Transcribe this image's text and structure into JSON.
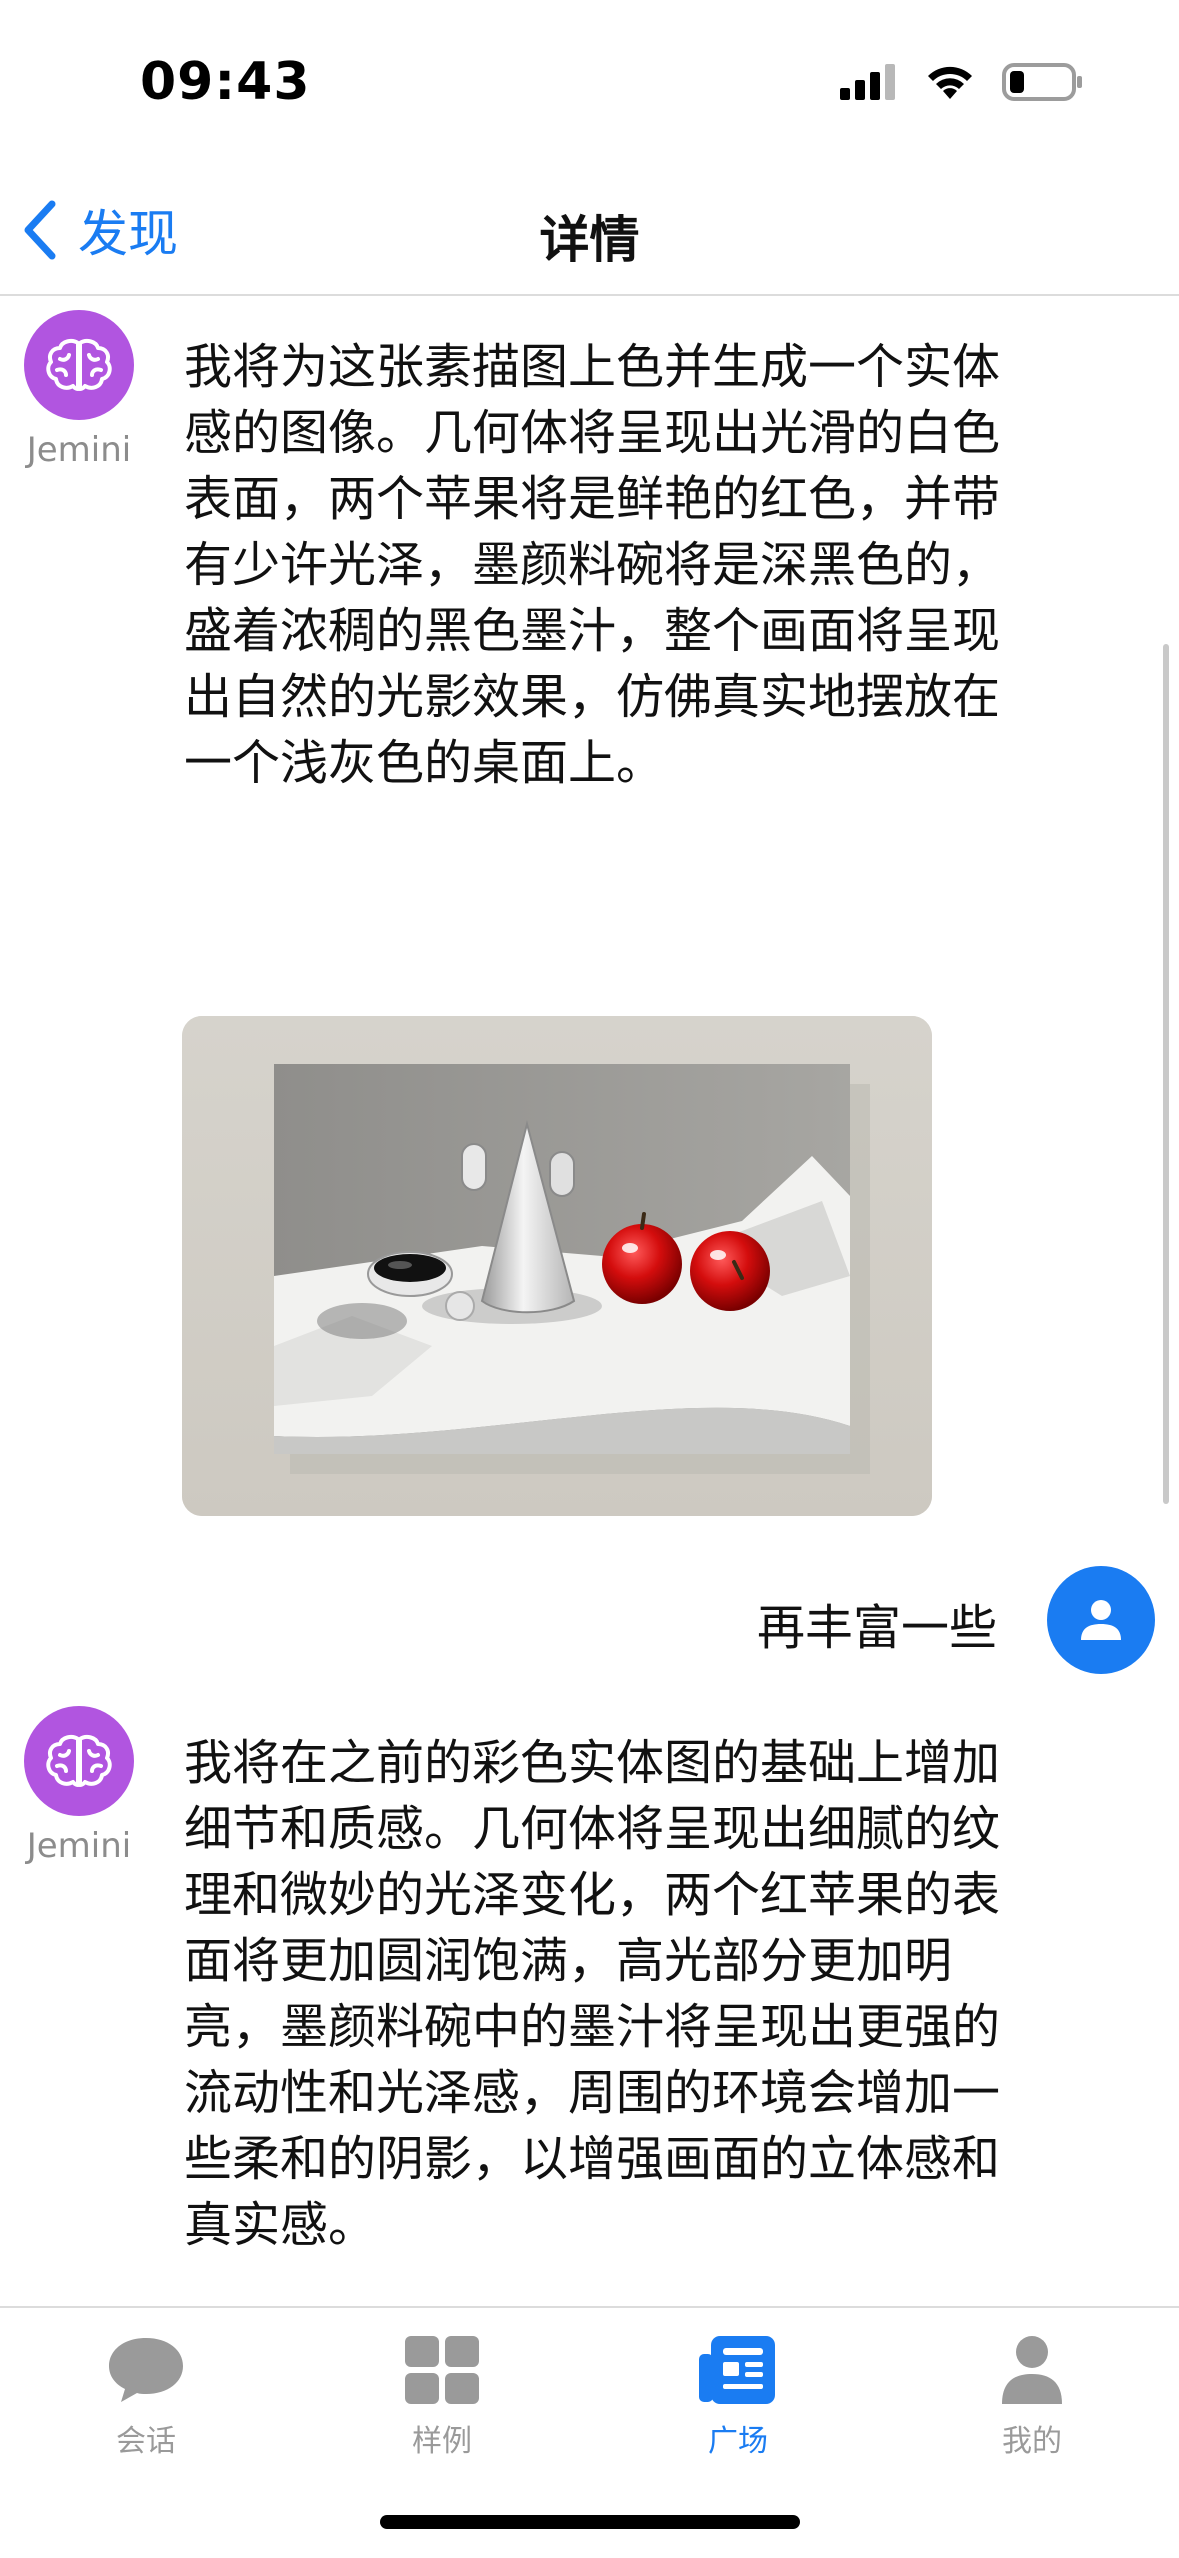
{
  "status_bar": {
    "time": "09:43"
  },
  "nav": {
    "back_label": "发现",
    "title": "详情"
  },
  "messages": [
    {
      "role": "bot",
      "sender": "Jemini",
      "text": "我将为这张素描图上色并生成一个实体感的图像。几何体将呈现出光滑的白色表面，两个苹果将是鲜艳的红色，并带有少许光泽，墨颜料碗将是深黑色的，盛着浓稠的黑色墨汁，整个画面将呈现出自然的光影效果，仿佛真实地摆放在一个浅灰色的桌面上。"
    },
    {
      "role": "user",
      "text": "再丰富一些"
    },
    {
      "role": "bot",
      "sender": "Jemini",
      "text": "我将在之前的彩色实体图的基础上增加细节和质感。几何体将呈现出细腻的纹理和微妙的光泽变化，两个红苹果的表面将更加圆润饱满，高光部分更加明亮，墨颜料碗中的墨汁将呈现出更强的流动性和光泽感，周围的环境会增加一些柔和的阴影，以增强画面的立体感和真实感。"
    }
  ],
  "tabs": [
    {
      "label": "会话",
      "icon": "chat-bubble-icon",
      "active": false
    },
    {
      "label": "样例",
      "icon": "grid-icon",
      "active": false
    },
    {
      "label": "广场",
      "icon": "news-icon",
      "active": true
    },
    {
      "label": "我的",
      "icon": "person-icon",
      "active": false
    }
  ],
  "colors": {
    "accent": "#1a7cf2",
    "bot_avatar": "#b155e0",
    "inactive_tab": "#9a9a9a"
  }
}
